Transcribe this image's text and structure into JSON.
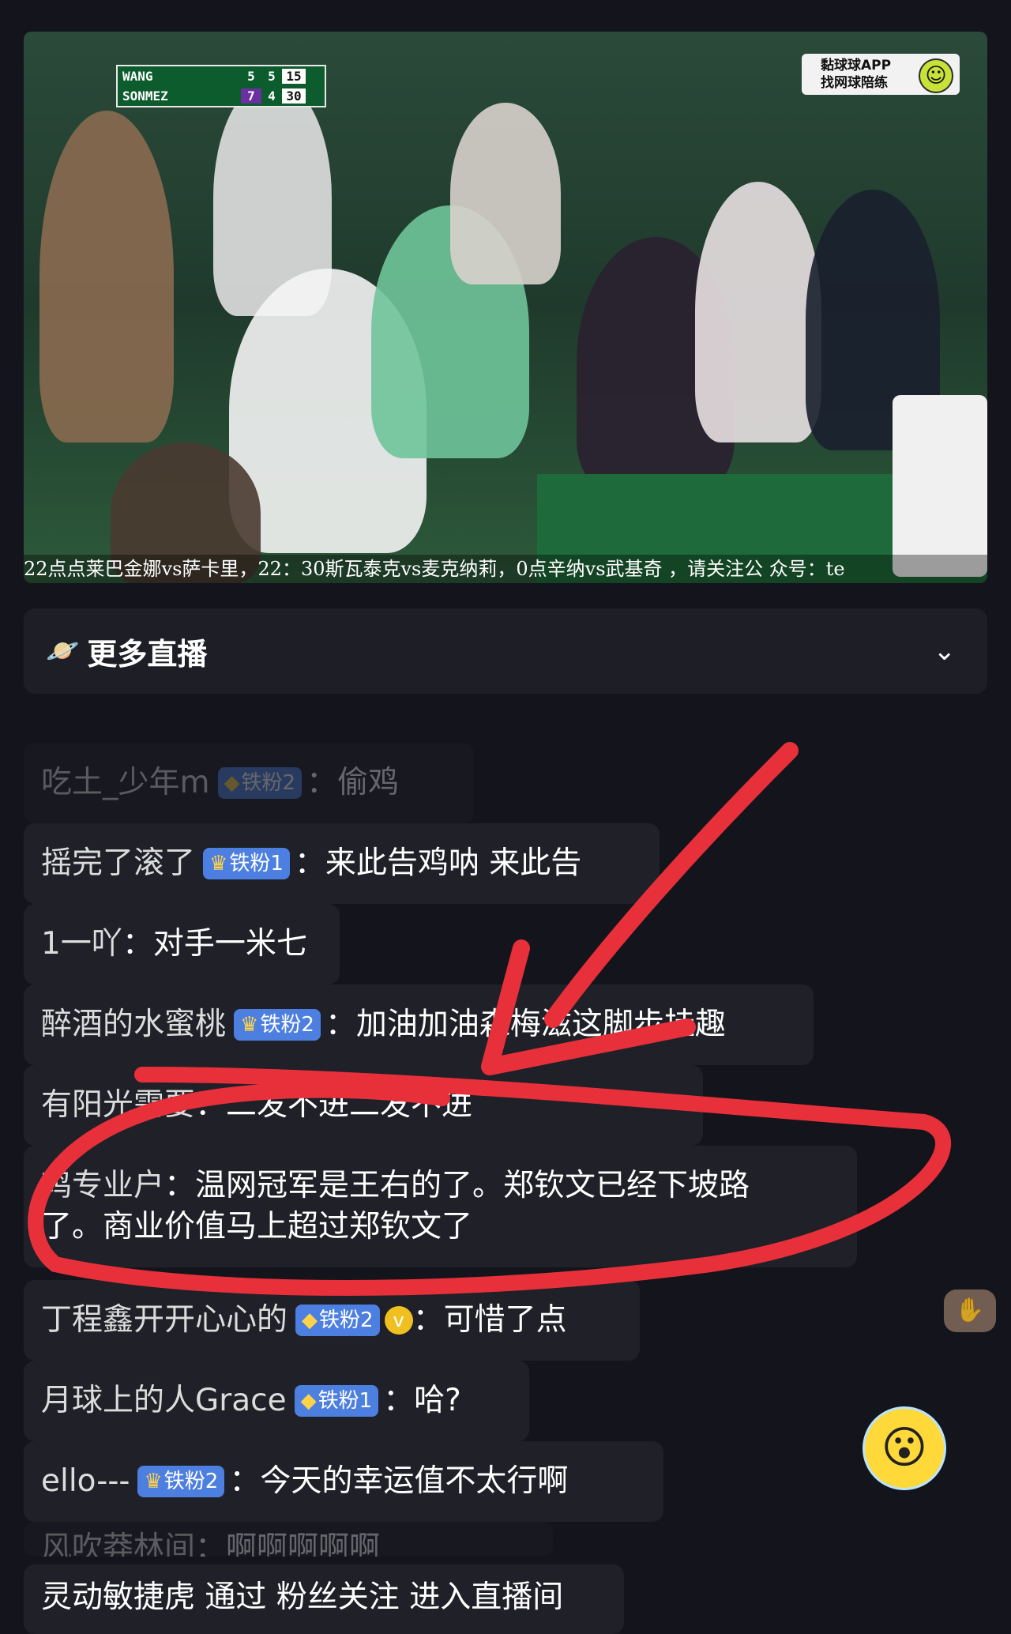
{
  "video": {
    "scoreboard": {
      "players": [
        {
          "name": "WANG",
          "sets": [
            "5",
            "5"
          ],
          "points": "15"
        },
        {
          "name": "SONMEZ",
          "sets": [
            "7",
            "4"
          ],
          "points": "30"
        }
      ]
    },
    "app_badge": {
      "line1": "黏球球APP",
      "line2": "找网球陪练"
    },
    "ticker": "22点点莱巴金娜vs萨卡里，22：30斯瓦泰克vs麦克纳莉，0点辛纳vs武基奇 ，请关注公 众号：te"
  },
  "more_live": {
    "icon": "planet-icon",
    "label": "更多直播",
    "chevron": "chevron-down-icon"
  },
  "comments": [
    {
      "user": "吃土_少年m",
      "badge": "铁粉2",
      "text": "偷鸡"
    },
    {
      "user": "摇完了滚了",
      "badge": "铁粉1",
      "text": "来此告鸡呐 来此告"
    },
    {
      "user": "1一吖",
      "text": "对手一米七"
    },
    {
      "user": "醉酒的水蜜桃",
      "badge": "铁粉2",
      "text": "加油加油森梅滋这脚步挂趣"
    },
    {
      "user": "有阳光需要",
      "text": "二发不进二发不进"
    },
    {
      "user": "鸡专业户",
      "text": "温网冠军是王右的了。郑钦文已经下坡路",
      "text2": "了。商业价值马上超过郑钦文了"
    },
    {
      "user": "丁程鑫开开心心的",
      "badge": "铁粉2",
      "text": "可惜了点"
    },
    {
      "user": "月球上的人Grace",
      "badge": "铁粉1",
      "text": "哈?"
    },
    {
      "user": "ello---",
      "badge": "铁粉2",
      "text": "今天的幸运值不太行啊"
    },
    {
      "user": "风吹莽林间",
      "text": "啊啊啊啊啊"
    }
  ],
  "sep": "：",
  "entry_notice": "灵动敏捷虎 通过 粉丝关注 进入直播间",
  "annotation": {
    "color": "#e8303a"
  }
}
